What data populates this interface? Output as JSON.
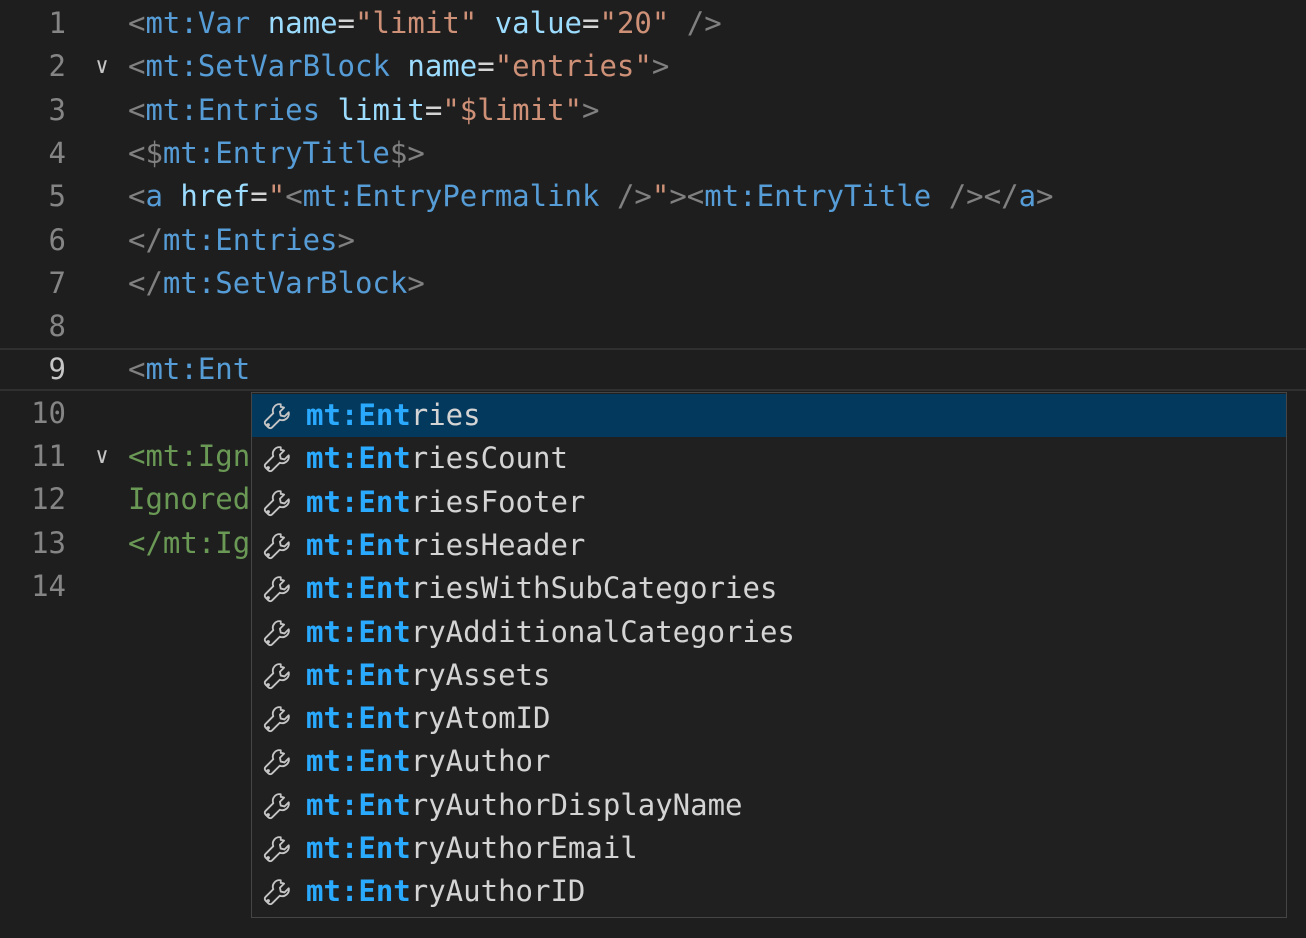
{
  "editor": {
    "lines": [
      {
        "num": "1",
        "tokens": [
          {
            "t": "<",
            "c": "t-punct"
          },
          {
            "t": "mt:Var",
            "c": "t-tag"
          },
          {
            "t": " ",
            "c": "t-text"
          },
          {
            "t": "name",
            "c": "t-attr"
          },
          {
            "t": "=",
            "c": "t-eq"
          },
          {
            "t": "\"limit\"",
            "c": "t-str"
          },
          {
            "t": " ",
            "c": "t-text"
          },
          {
            "t": "value",
            "c": "t-attr"
          },
          {
            "t": "=",
            "c": "t-eq"
          },
          {
            "t": "\"20\"",
            "c": "t-str"
          },
          {
            "t": " ",
            "c": "t-text"
          },
          {
            "t": "/>",
            "c": "t-punct"
          }
        ]
      },
      {
        "num": "2",
        "fold": "∨",
        "tokens": [
          {
            "t": "<",
            "c": "t-punct"
          },
          {
            "t": "mt:SetVarBlock",
            "c": "t-tag"
          },
          {
            "t": " ",
            "c": "t-text"
          },
          {
            "t": "name",
            "c": "t-attr"
          },
          {
            "t": "=",
            "c": "t-eq"
          },
          {
            "t": "\"entries\"",
            "c": "t-str"
          },
          {
            "t": ">",
            "c": "t-punct"
          }
        ]
      },
      {
        "num": "3",
        "tokens": [
          {
            "t": "<",
            "c": "t-punct"
          },
          {
            "t": "mt:Entries",
            "c": "t-tag"
          },
          {
            "t": " ",
            "c": "t-text"
          },
          {
            "t": "limit",
            "c": "t-attr"
          },
          {
            "t": "=",
            "c": "t-eq"
          },
          {
            "t": "\"$limit\"",
            "c": "t-str"
          },
          {
            "t": ">",
            "c": "t-punct"
          }
        ]
      },
      {
        "num": "4",
        "tokens": [
          {
            "t": "<$",
            "c": "t-punct"
          },
          {
            "t": "mt:EntryTitle",
            "c": "t-tag"
          },
          {
            "t": "$>",
            "c": "t-punct"
          }
        ]
      },
      {
        "num": "5",
        "tokens": [
          {
            "t": "<",
            "c": "t-punct"
          },
          {
            "t": "a",
            "c": "t-tag"
          },
          {
            "t": " ",
            "c": "t-text"
          },
          {
            "t": "href",
            "c": "t-attr"
          },
          {
            "t": "=",
            "c": "t-eq"
          },
          {
            "t": "\"",
            "c": "t-str"
          },
          {
            "t": "<",
            "c": "t-punct"
          },
          {
            "t": "mt:EntryPermalink",
            "c": "t-tag"
          },
          {
            "t": " ",
            "c": "t-text"
          },
          {
            "t": "/>",
            "c": "t-punct"
          },
          {
            "t": "\"",
            "c": "t-str"
          },
          {
            "t": ">",
            "c": "t-punct"
          },
          {
            "t": "<",
            "c": "t-punct"
          },
          {
            "t": "mt:EntryTitle",
            "c": "t-tag"
          },
          {
            "t": " ",
            "c": "t-text"
          },
          {
            "t": "/>",
            "c": "t-punct"
          },
          {
            "t": "</",
            "c": "t-punct"
          },
          {
            "t": "a",
            "c": "t-tag"
          },
          {
            "t": ">",
            "c": "t-punct"
          }
        ]
      },
      {
        "num": "6",
        "tokens": [
          {
            "t": "</",
            "c": "t-punct"
          },
          {
            "t": "mt:Entries",
            "c": "t-tag"
          },
          {
            "t": ">",
            "c": "t-punct"
          }
        ]
      },
      {
        "num": "7",
        "tokens": [
          {
            "t": "</",
            "c": "t-punct"
          },
          {
            "t": "mt:SetVarBlock",
            "c": "t-tag"
          },
          {
            "t": ">",
            "c": "t-punct"
          }
        ]
      },
      {
        "num": "8",
        "tokens": []
      },
      {
        "num": "9",
        "current": true,
        "tokens": [
          {
            "t": "<",
            "c": "t-punct"
          },
          {
            "t": "mt:Ent",
            "c": "t-tag"
          }
        ]
      },
      {
        "num": "10",
        "tokens": []
      },
      {
        "num": "11",
        "fold": "∨",
        "tokens": [
          {
            "t": "<mt:Ign",
            "c": "t-comment"
          }
        ]
      },
      {
        "num": "12",
        "tokens": [
          {
            "t": "Ignored",
            "c": "t-comment"
          }
        ]
      },
      {
        "num": "13",
        "tokens": [
          {
            "t": "</mt:Ig",
            "c": "t-comment"
          }
        ]
      },
      {
        "num": "14",
        "tokens": []
      }
    ]
  },
  "suggest": {
    "icon": "wrench-icon",
    "match_prefix": "mt:Ent",
    "selected_index": 0,
    "items": [
      {
        "match": "mt:Ent",
        "rest": "ries"
      },
      {
        "match": "mt:Ent",
        "rest": "riesCount"
      },
      {
        "match": "mt:Ent",
        "rest": "riesFooter"
      },
      {
        "match": "mt:Ent",
        "rest": "riesHeader"
      },
      {
        "match": "mt:Ent",
        "rest": "riesWithSubCategories"
      },
      {
        "match": "mt:Ent",
        "rest": "ryAdditionalCategories"
      },
      {
        "match": "mt:Ent",
        "rest": "ryAssets"
      },
      {
        "match": "mt:Ent",
        "rest": "ryAtomID"
      },
      {
        "match": "mt:Ent",
        "rest": "ryAuthor"
      },
      {
        "match": "mt:Ent",
        "rest": "ryAuthorDisplayName"
      },
      {
        "match": "mt:Ent",
        "rest": "ryAuthorEmail"
      },
      {
        "match": "mt:Ent",
        "rest": "ryAuthorID"
      }
    ]
  },
  "colors": {
    "background": "#1e1e1e",
    "tag": "#569cd6",
    "attribute": "#9cdcfe",
    "string": "#ce9178",
    "comment": "#6a9955",
    "match_highlight": "#2aaaff",
    "selection": "#04395e"
  }
}
